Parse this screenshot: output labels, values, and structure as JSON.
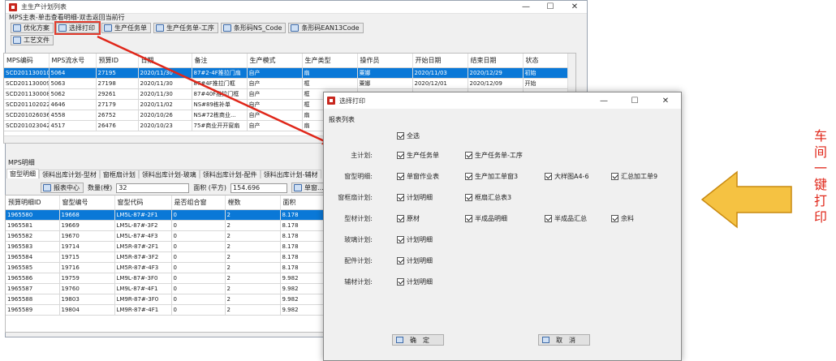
{
  "main_window": {
    "title": "主生产计划列表",
    "hint": "MPS主表-单击查看明细-双击返回当前行",
    "controls": [
      "—",
      "☐",
      "✕"
    ],
    "toolbar": [
      "优化方案",
      "选择打印",
      "生产任务单",
      "生产任务单-工序",
      "条形码NS_Code",
      "条形码EAN13Code"
    ],
    "toolbar2": [
      "工艺文件"
    ],
    "mps_table": {
      "headers": [
        "MPS编码",
        "MPS流水号",
        "预算ID",
        "日期",
        "备注",
        "生产模式",
        "生产类型",
        "操作员",
        "开始日期",
        "结束日期",
        "状态"
      ],
      "rows": [
        [
          "SCD201130010",
          "5064",
          "27195",
          "2020/11/30",
          "87#2-4F推拉门扇",
          "自产",
          "扇",
          "粟娜",
          "2020/11/03",
          "2020/12/29",
          "初始"
        ],
        [
          "SCD201130009",
          "5063",
          "27198",
          "2020/11/30",
          "87#4F推拉门框",
          "自产",
          "框",
          "粟娜",
          "2020/12/01",
          "2020/12/09",
          "开始"
        ],
        [
          "SCD201130008",
          "5062",
          "29261",
          "2020/11/30",
          "87#40F推拉门框",
          "自产",
          "框",
          "",
          "",
          "",
          ""
        ],
        [
          "SCD201102022",
          "4646",
          "27179",
          "2020/11/02",
          "NS#89栋补单",
          "自产",
          "框",
          "",
          "",
          "",
          ""
        ],
        [
          "SCD201026036",
          "4558",
          "26752",
          "2020/10/26",
          "NS#72栋商业...",
          "自产",
          "扇",
          "",
          "",
          "",
          ""
        ],
        [
          "SCD201023042",
          "4517",
          "26476",
          "2020/10/23",
          "75#商业开开窗扇",
          "自产",
          "扇",
          "",
          "",
          "",
          ""
        ]
      ]
    },
    "detail_label": "MPS明细",
    "tabs": [
      "窗型明细",
      "领料出库计划-型材",
      "窗框扇计划",
      "领料出库计划-玻璃",
      "领料出库计划-配件",
      "领料出库计划-辅材"
    ],
    "detail_toolbar": {
      "report_center": "报表中心",
      "qty_label": "数量(樘)",
      "qty_value": "32",
      "area_label": "面积 (平方)",
      "area_value": "154.696",
      "single_print": "单窗..."
    },
    "detail_table": {
      "headers": [
        "预算明细ID",
        "窗型编号",
        "窗型代码",
        "是否组合窗",
        "樘数",
        "面积"
      ],
      "rows": [
        [
          "1965580",
          "19668",
          "LM5L-87#-2F1",
          "0",
          "2",
          "8.178"
        ],
        [
          "1965581",
          "19669",
          "LM5L-87#-3F2",
          "0",
          "2",
          "8.178"
        ],
        [
          "1965582",
          "19670",
          "LM5L-87#-4F3",
          "0",
          "2",
          "8.178"
        ],
        [
          "1965583",
          "19714",
          "LM5R-87#-2F1",
          "0",
          "2",
          "8.178"
        ],
        [
          "1965584",
          "19715",
          "LM5R-87#-3F2",
          "0",
          "2",
          "8.178"
        ],
        [
          "1965585",
          "19716",
          "LM5R-87#-4F3",
          "0",
          "2",
          "8.178"
        ],
        [
          "1965586",
          "19759",
          "LM9L-87#-3F0",
          "0",
          "2",
          "9.982"
        ],
        [
          "1965587",
          "19760",
          "LM9L-87#-4F1",
          "0",
          "2",
          "9.982"
        ],
        [
          "1965588",
          "19803",
          "LM9R-87#-3F0",
          "0",
          "2",
          "9.982"
        ],
        [
          "1965589",
          "19804",
          "LM9R-87#-4F1",
          "0",
          "2",
          "9.982"
        ]
      ]
    }
  },
  "dialog": {
    "title": "选择打印",
    "controls": [
      "—",
      "☐",
      "✕"
    ],
    "section": "报表列表",
    "select_all": "全选",
    "groups": [
      {
        "label": "主计划:",
        "items": [
          "生产任务单",
          "生产任务单-工序"
        ]
      },
      {
        "label": "窗型明细:",
        "items": [
          "单窗作业表",
          "生产加工单窗3",
          "大样图A4-6",
          "汇总加工单9"
        ]
      },
      {
        "label": "窗框扇计划:",
        "items": [
          "计划明细",
          "框扇汇总表3"
        ]
      },
      {
        "label": "型材计划:",
        "items": [
          "原材",
          "半成品明细",
          "半成品汇总",
          "余料"
        ]
      },
      {
        "label": "玻璃计划:",
        "items": [
          "计划明细"
        ]
      },
      {
        "label": "配件计划:",
        "items": [
          "计划明细"
        ]
      },
      {
        "label": "辅材计划:",
        "items": [
          "计划明细"
        ]
      }
    ],
    "ok": "确　定",
    "cancel": "取　消"
  },
  "annotation": {
    "text": "车间一键打印",
    "color": "#e0271a",
    "arrow_fill": "#f5c242",
    "arrow_stroke": "#c98a10"
  }
}
